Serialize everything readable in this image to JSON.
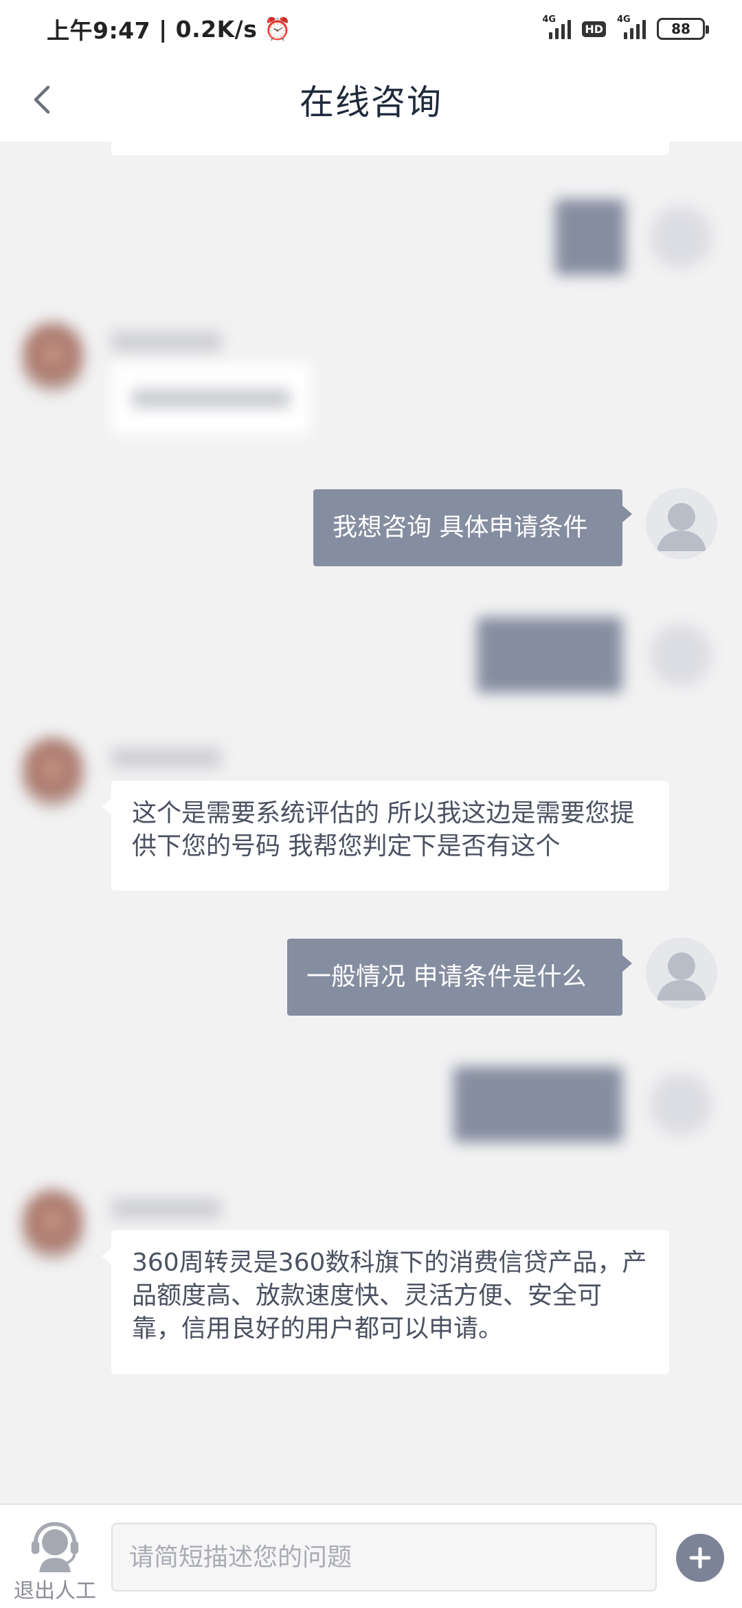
{
  "status_bar": {
    "time": "上午9:47",
    "net_speed": "0.2K/s",
    "alarm_icon": "alarm-clock-icon",
    "net1": "4G",
    "hd": "HD",
    "net2": "4G",
    "battery": "88"
  },
  "header": {
    "title": "在线咨询",
    "back_icon": "chevron-left-icon"
  },
  "messages": [
    {
      "from": "user",
      "text": "我想咨询 具体申请条件"
    },
    {
      "from": "agent",
      "text": "这个是需要系统评估的 所以我这边是需要您提供下您的号码 我帮您判定下是否有这个"
    },
    {
      "from": "user",
      "text": "一般情况 申请条件是什么"
    },
    {
      "from": "agent",
      "text": "360周转灵是360数科旗下的消费信贷产品，产品额度高、放款速度快、灵活方便、安全可靠，信用良好的用户都可以申请。"
    }
  ],
  "bottom_bar": {
    "exit_label": "退出人工",
    "exit_icon": "headset-agent-icon",
    "input_placeholder": "请简短描述您的问题",
    "plus_icon": "plus-icon"
  },
  "colors": {
    "user_bubble": "#858da0",
    "agent_bubble": "#ffffff",
    "background": "#f2f2f3"
  }
}
